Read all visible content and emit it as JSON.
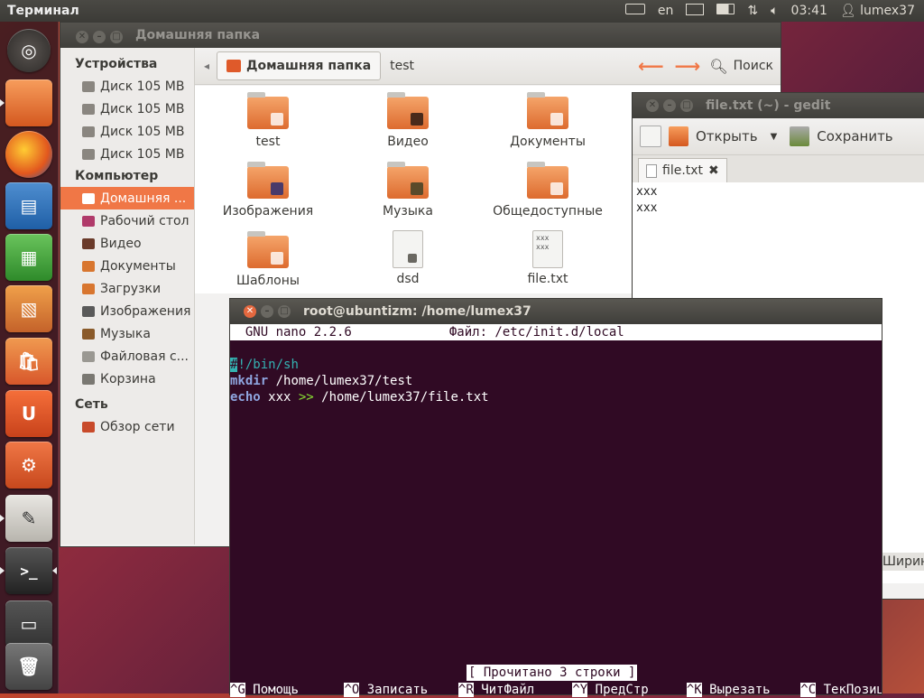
{
  "top_panel": {
    "app_title": "Терминал",
    "keyboard_layout": "en",
    "time": "03:41",
    "user": "lumex37",
    "icons": [
      "keyboard-icon",
      "mail-icon",
      "battery-icon",
      "network-icon",
      "volume-icon",
      "user-icon"
    ]
  },
  "launcher": {
    "items": [
      "ubuntu-dash",
      "files",
      "firefox",
      "libreoffice-writer",
      "libreoffice-calc",
      "libreoffice-impress",
      "ubuntu-software-center",
      "ubuntu-one",
      "system-settings",
      "text-editor",
      "terminal",
      "workspace-switcher",
      "trash"
    ]
  },
  "files_window": {
    "title": "Домашняя папка",
    "sidebar": {
      "devices_heading": "Устройства",
      "devices": [
        "Диск 105 MB",
        "Диск 105 MB",
        "Диск 105 MB",
        "Диск 105 MB"
      ],
      "computer_heading": "Компьютер",
      "computer": [
        "Домашняя ...",
        "Рабочий стол",
        "Видео",
        "Документы",
        "Загрузки",
        "Изображения",
        "Музыка",
        "Файловая с...",
        "Корзина"
      ],
      "network_heading": "Сеть",
      "network": [
        "Обзор сети"
      ]
    },
    "toolbar": {
      "crumb_home": "Домашняя папка",
      "crumb_test": "test",
      "search_label": "Поиск"
    },
    "items": [
      {
        "name": "test",
        "kind": "folder"
      },
      {
        "name": "Видео",
        "kind": "folder"
      },
      {
        "name": "Документы",
        "kind": "folder"
      },
      {
        "name": "Изображения",
        "kind": "folder"
      },
      {
        "name": "Музыка",
        "kind": "folder"
      },
      {
        "name": "Общедоступные",
        "kind": "folder"
      },
      {
        "name": "Шаблоны",
        "kind": "folder"
      },
      {
        "name": "dsd",
        "kind": "file"
      },
      {
        "name": "file.txt",
        "kind": "text"
      }
    ],
    "file_preview": "xxx\nxxx"
  },
  "gedit_window": {
    "title": "file.txt (~) - gedit",
    "toolbar": {
      "open_label": "Открыть",
      "save_label": "Сохранить"
    },
    "tab_label": "file.txt",
    "lines": [
      "xxx",
      "xxx"
    ],
    "partial_label": "Ширин"
  },
  "terminal_window": {
    "title": "root@ubuntizm: /home/lumex37",
    "nano_version": "  GNU nano 2.2.6",
    "nano_file": "Файл: /etc/init.d/local",
    "code": {
      "shebang_hash": "#",
      "shebang_rest": "!/bin/sh",
      "line2_cmd": "mkdir",
      "line2_arg": " /home/lumex37/test",
      "line3_cmd": "echo",
      "line3_arg1": " xxx ",
      "line3_op": ">>",
      "line3_arg2": " /home/lumex37/file.txt"
    },
    "status": "[ Прочитано 3 строки ]",
    "shortcuts": [
      {
        "key": "^G",
        "label": "Помощь"
      },
      {
        "key": "^O",
        "label": "Записать"
      },
      {
        "key": "^R",
        "label": "ЧитФайл"
      },
      {
        "key": "^Y",
        "label": "ПредСтр"
      },
      {
        "key": "^K",
        "label": "Вырезать"
      },
      {
        "key": "^C",
        "label": "ТекПозиц"
      }
    ]
  }
}
